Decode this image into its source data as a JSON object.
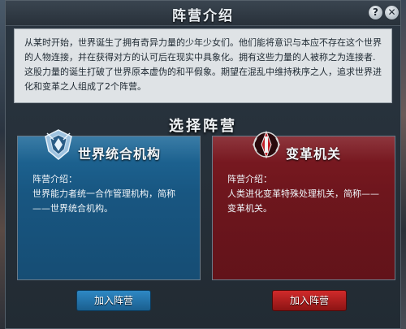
{
  "dialog": {
    "title": "阵营介绍",
    "help_label": "?",
    "close_label": "✕"
  },
  "intro": {
    "text": "从某时开始，世界诞生了拥有奇异力量的少年少女们。他们能将意识与本应不存在这个世界的人物连接，并在获得对方的认可后在现实中具象化。拥有这些力量的人被称之为连接者.这股力量的诞生打破了世界原本虚伪的和平假象。期望在混乱中维持秩序之人，追求世界进化和变革之人组成了2个阵营。"
  },
  "section_title": "选择阵营",
  "factions": [
    {
      "name": "世界统合机构",
      "intro_label": "阵营介绍：",
      "description": "世界能力者统一合作管理机构，简称——世界统合机构。",
      "join_label": "加入阵营",
      "color": "#185681"
    },
    {
      "name": "变革机关",
      "intro_label": "阵营介绍：",
      "description": "人类进化变革特殊处理机关，简称——变革机关。",
      "join_label": "加入阵营",
      "color": "#6e161d"
    }
  ]
}
